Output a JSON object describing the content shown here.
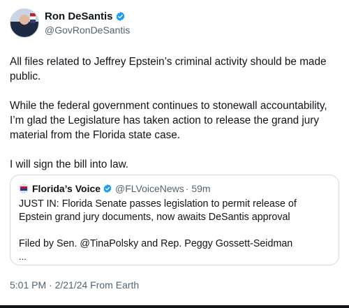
{
  "author": {
    "display_name": "Ron DeSantis",
    "handle": "@GovRonDeSantis",
    "verified_icon": "verified-badge-icon"
  },
  "tweet": {
    "paragraphs": [
      "All files related to Jeffrey Epstein’s criminal activity should be made public.",
      "While the federal government continues to stonewall accountability, I’m glad the Legislature has taken action to release the grand jury material from the Florida state case.",
      "I will sign the bill into law."
    ],
    "timestamp": "5:01 PM · 2/21/24 From Earth"
  },
  "quoted_tweet": {
    "display_name": "Florida’s Voice",
    "handle": "@FLVoiceNews",
    "time_ago": "· 59m",
    "paragraphs": [
      "JUST IN: Florida Senate passes legislation to permit release of Epstein grand jury documents, now awaits DeSantis approval",
      "Filed by Sen. @TinaPolsky and Rep. Peggy Gossett-Seidman"
    ],
    "truncation": "..."
  },
  "colors": {
    "text": "#0f1419",
    "secondary_text": "#536471",
    "verified_blue": "#1d9bf0",
    "border": "#cfd9de"
  }
}
